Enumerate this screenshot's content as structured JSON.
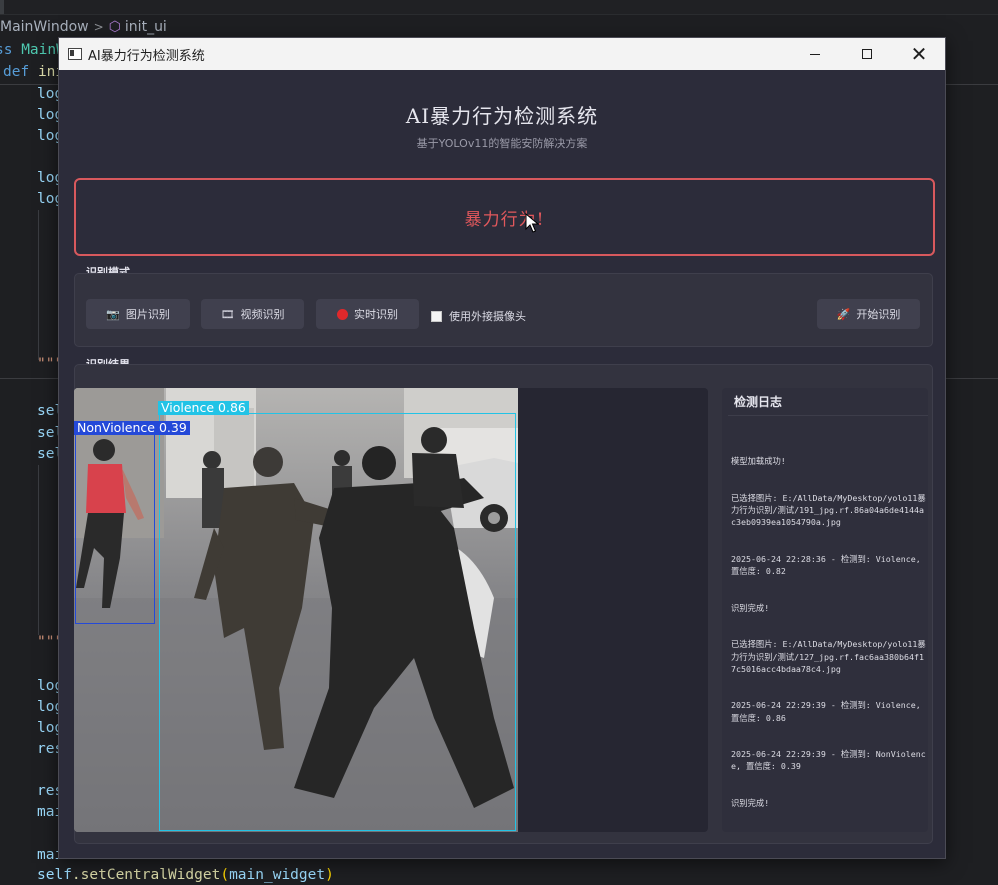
{
  "ide": {
    "breadcrumb": {
      "class_name": "MainWindow",
      "separator": ">",
      "method_name": "init_ui"
    },
    "code": {
      "line_class": {
        "kw": "ss",
        "name": "MainW"
      },
      "line_def": {
        "kw": "def",
        "name": "ini"
      },
      "frag_log": "log",
      "frag_doc": "\"\"\"",
      "frag_sel": "sel",
      "frag_res": "res",
      "frag_mai": "mai",
      "last_line": {
        "self": "self",
        "call": ".setCentralWidget",
        "arg": "main_widget",
        "close": ")"
      }
    }
  },
  "window": {
    "title": "AI暴力行为检测系统",
    "controls": {
      "minimize": "minimize",
      "maximize": "maximize",
      "close": "✕"
    }
  },
  "header": {
    "title": "AI暴力行为检测系统",
    "subtitle": "基于YOLOv11的智能安防解决方案"
  },
  "alert": {
    "text": "暴力行为!",
    "color": "#e2585c"
  },
  "mode_group": {
    "label": "识别模式",
    "buttons": {
      "image": {
        "label": "图片识别",
        "icon": "camera-icon"
      },
      "video": {
        "label": "视频识别",
        "icon": "film-icon"
      },
      "realtime": {
        "label": "实时识别",
        "icon": "record-icon"
      },
      "start": {
        "label": "开始识别",
        "icon": "rocket-icon"
      }
    },
    "external_camera": {
      "label": "使用外接摄像头",
      "checked": false
    }
  },
  "result_group": {
    "label": "识别结果",
    "detections": [
      {
        "label": "Violence",
        "confidence": "0.86",
        "color": "#22c3e6"
      },
      {
        "label": "NonViolence",
        "confidence": "0.39",
        "color": "#2449d8"
      }
    ]
  },
  "log": {
    "title": "检测日志",
    "entries": [
      "模型加载成功!",
      "已选择图片: E:/AllData/MyDesktop/yolo11暴力行为识别/测试/191_jpg.rf.86a04a6de4144ac3eb0939ea1054790a.jpg",
      "2025-06-24 22:28:36 - 检测到: Violence, 置信度: 0.82",
      "识别完成!",
      "已选择图片: E:/AllData/MyDesktop/yolo11暴力行为识别/测试/127_jpg.rf.fac6aa380b64f17c5016acc4bdaa78c4.jpg",
      "2025-06-24 22:29:39 - 检测到: Violence, 置信度: 0.86",
      "2025-06-24 22:29:39 - 检测到: NonViolence, 置信度: 0.39",
      "识别完成!"
    ]
  }
}
